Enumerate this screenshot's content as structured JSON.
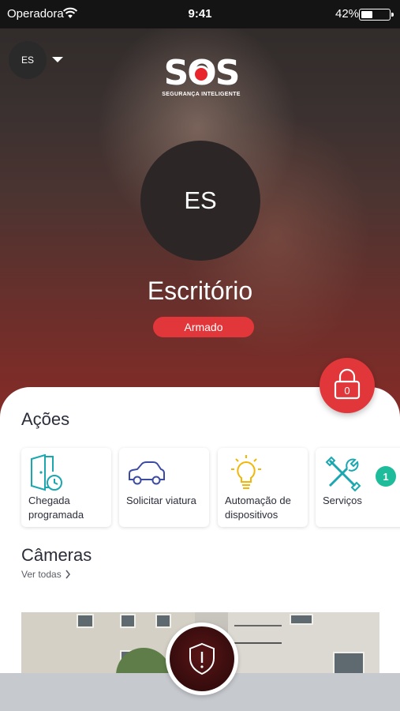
{
  "status_bar": {
    "carrier": "Operadora",
    "time": "9:41",
    "battery_percent": "42%",
    "battery_level": 0.42
  },
  "header": {
    "profile_initials": "ES",
    "logo_text": "SOS",
    "logo_subtitle": "SEGURANÇA INTELIGENTE"
  },
  "place": {
    "initials": "ES",
    "name": "Escritório",
    "status": "Armado",
    "status_color": "#e2373a"
  },
  "lock_button": {
    "count": "0",
    "icon": "padlock-icon"
  },
  "actions": {
    "title": "Ações",
    "items": [
      {
        "label": "Chegada programada",
        "icon": "door-clock-icon"
      },
      {
        "label": "Solicitar viatura",
        "icon": "car-icon"
      },
      {
        "label": "Automação de dispositivos",
        "icon": "lightbulb-icon"
      },
      {
        "label": "Serviços",
        "icon": "tools-icon"
      }
    ],
    "badge": "1",
    "badge_color": "#1ebc9b"
  },
  "cameras": {
    "title": "Câmeras",
    "see_all": "Ver todas"
  },
  "panic_button": {
    "icon": "shield-alert-icon"
  },
  "colors": {
    "accent_red": "#e2373a",
    "text_dark": "#2b2d3a",
    "icon_teal": "#1aa7b0",
    "icon_blue": "#3b4aa3",
    "icon_yellow": "#f2b705",
    "teal_badge": "#1ebc9b"
  }
}
